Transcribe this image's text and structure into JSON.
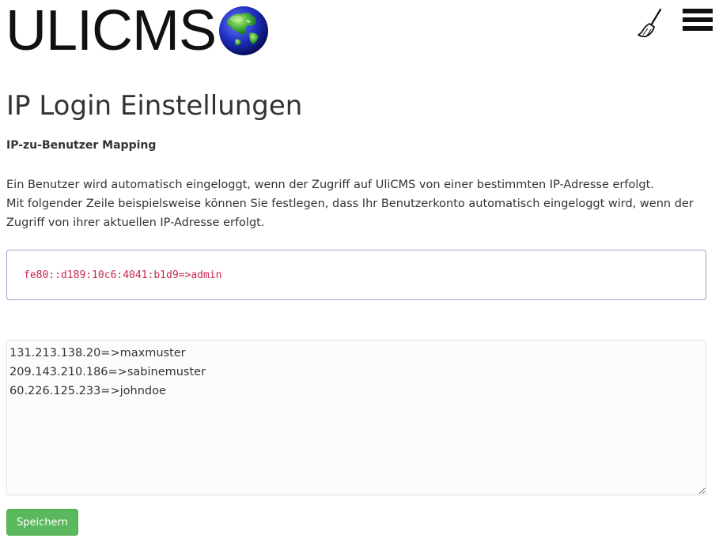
{
  "header": {
    "logo_text": "ULICMS",
    "icons": [
      "globe-icon",
      "broom-icon",
      "hamburger-menu-icon"
    ]
  },
  "page": {
    "title": "IP Login Einstellungen",
    "subtitle": "IP-zu-Benutzer Mapping",
    "description_line1": "Ein Benutzer wird automatisch eingeloggt, wenn der Zugriff auf UliCMS von einer bestimmten IP-Adresse erfolgt.",
    "description_line2": "Mit folgender Zeile beispielsweise können Sie festlegen, dass Ihr Benutzerkonto automatisch eingeloggt wird, wenn der Zugriff von ihrer aktuellen IP-Adresse erfolgt.",
    "example_code": "fe80::d189:10c6:4041:b1d9=>admin",
    "mapping_value": "131.213.138.20=>maxmuster\n209.143.210.186=>sabinemuster\n60.226.125.233=>johndoe",
    "save_label": "Speichern"
  },
  "colors": {
    "code": "#c7254e",
    "save_button": "#5cb85c",
    "code_border": "#9aa0d0"
  }
}
